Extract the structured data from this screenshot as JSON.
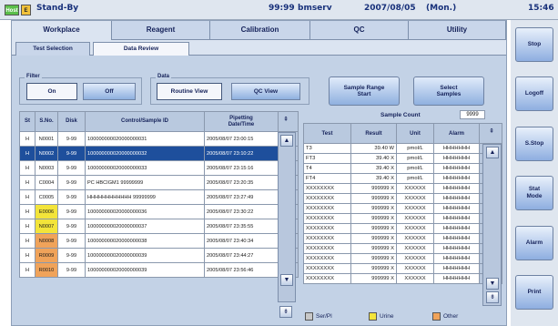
{
  "status": {
    "host": "Host",
    "e": "E",
    "mode": "Stand-By",
    "time_left": "99:99",
    "user": "bmserv",
    "date": "2007/08/05",
    "weekday": "(Mon.)",
    "time": "15:46"
  },
  "tabs": [
    "Workplace",
    "Reagent",
    "Calibration",
    "QC",
    "Utility"
  ],
  "subtabs": [
    "Test Selection",
    "Data Review"
  ],
  "filter": {
    "label": "Filter",
    "on": "On",
    "off": "Off"
  },
  "data_group": {
    "label": "Data",
    "routine": "Routine View",
    "qc": "QC View"
  },
  "sample_range_start": "Sample Range\nStart",
  "select_samples": "Select\nSamples",
  "sample_count": {
    "label": "Sample Count",
    "value": "9999"
  },
  "left_table": {
    "headers": [
      "St",
      "S.No.",
      "Disk",
      "Control/Sample ID",
      "Pipetting\nDate/Time"
    ],
    "rows": [
      {
        "st": "H",
        "sno": "N0001",
        "disk": "9-99",
        "id": "100000000020000000031",
        "dt": "2005/08/07 23:00:15",
        "color": "#ffffff"
      },
      {
        "st": "H",
        "sno": "N0002",
        "disk": "9-99",
        "id": "100000000020000000032",
        "dt": "2005/08/07 23:10:22",
        "color": "#ffffff"
      },
      {
        "st": "H",
        "sno": "N0003",
        "disk": "9-99",
        "id": "100000000020000000033",
        "dt": "2005/08/07 23:15:16",
        "color": "#ffffff"
      },
      {
        "st": "H",
        "sno": "C0004",
        "disk": "9-99",
        "id": "PC HBCIGM1 99999999",
        "dt": "2005/08/07 23:20:35",
        "color": "#ffffff"
      },
      {
        "st": "H",
        "sno": "C0005",
        "disk": "9-99",
        "id": "HHHHHHHHHHHH 99999999",
        "dt": "2005/08/07 23:27:49",
        "color": "#ffffff"
      },
      {
        "st": "H",
        "sno": "E0006",
        "disk": "9-99",
        "id": "100000000020000000036",
        "dt": "2005/08/07 23:30:22",
        "color": "#f3e43a"
      },
      {
        "st": "H",
        "sno": "N0007",
        "disk": "9-99",
        "id": "100000000020000000037",
        "dt": "2005/08/07 23:35:55",
        "color": "#f3e43a"
      },
      {
        "st": "H",
        "sno": "N0008",
        "disk": "9-99",
        "id": "100000000020000000038",
        "dt": "2005/08/07 23:40:34",
        "color": "#f0a35a"
      },
      {
        "st": "H",
        "sno": "R0009",
        "disk": "9-99",
        "id": "100000000020000000039",
        "dt": "2005/08/07 23:44:27",
        "color": "#f0a35a"
      },
      {
        "st": "H",
        "sno": "R0010",
        "disk": "9-99",
        "id": "100000000020000000039",
        "dt": "2005/08/07 23:56:46",
        "color": "#f0a35a"
      }
    ],
    "selected_index": 1
  },
  "right_table": {
    "headers": [
      "Test",
      "Result",
      "Unit",
      "Alarm"
    ],
    "rows": [
      {
        "test": "T3",
        "result": "39.40 W",
        "unit": "pmol/L",
        "alarm": "HHHHHHH"
      },
      {
        "test": "FT3",
        "result": "39.40 X",
        "unit": "pmol/L",
        "alarm": "HHHHHHH"
      },
      {
        "test": "T4",
        "result": "39.40 X",
        "unit": "pmol/L",
        "alarm": "HHHHHHH"
      },
      {
        "test": "FT4",
        "result": "39.40 X",
        "unit": "pmol/L",
        "alarm": "HHHHHHH"
      },
      {
        "test": "XXXXXXXX",
        "result": "999999 X",
        "unit": "XXXXXX",
        "alarm": "HHHHHHH"
      },
      {
        "test": "XXXXXXXX",
        "result": "999999 X",
        "unit": "XXXXXX",
        "alarm": "HHHHHHH"
      },
      {
        "test": "XXXXXXXX",
        "result": "999999 X",
        "unit": "XXXXXX",
        "alarm": "HHHHHHH"
      },
      {
        "test": "XXXXXXXX",
        "result": "999999 X",
        "unit": "XXXXXX",
        "alarm": "HHHHHHH"
      },
      {
        "test": "XXXXXXXX",
        "result": "999999 X",
        "unit": "XXXXXX",
        "alarm": "HHHHHHH"
      },
      {
        "test": "XXXXXXXX",
        "result": "999999 X",
        "unit": "XXXXXX",
        "alarm": "HHHHHHH"
      },
      {
        "test": "XXXXXXXX",
        "result": "999999 X",
        "unit": "XXXXXX",
        "alarm": "HHHHHHH"
      },
      {
        "test": "XXXXXXXX",
        "result": "999999 X",
        "unit": "XXXXXX",
        "alarm": "HHHHHHH"
      },
      {
        "test": "XXXXXXXX",
        "result": "999999 X",
        "unit": "XXXXXX",
        "alarm": "HHHHHHH"
      },
      {
        "test": "XXXXXXXX",
        "result": "999999 X",
        "unit": "XXXXXX",
        "alarm": "HHHHHHH"
      }
    ]
  },
  "legend": [
    {
      "label": "Ser/Pl",
      "color": "#c8c8c8"
    },
    {
      "label": "Urine",
      "color": "#f3e43a"
    },
    {
      "label": "Other",
      "color": "#f0a35a"
    }
  ],
  "side_buttons": [
    "Stop",
    "Logoff",
    "S.Stop",
    "Stat\nMode",
    "Alarm",
    "Print"
  ],
  "colors": {
    "selected_row": "#1e4f9c",
    "panel": "#c3d2e6",
    "accent": "#5b8fd6"
  }
}
